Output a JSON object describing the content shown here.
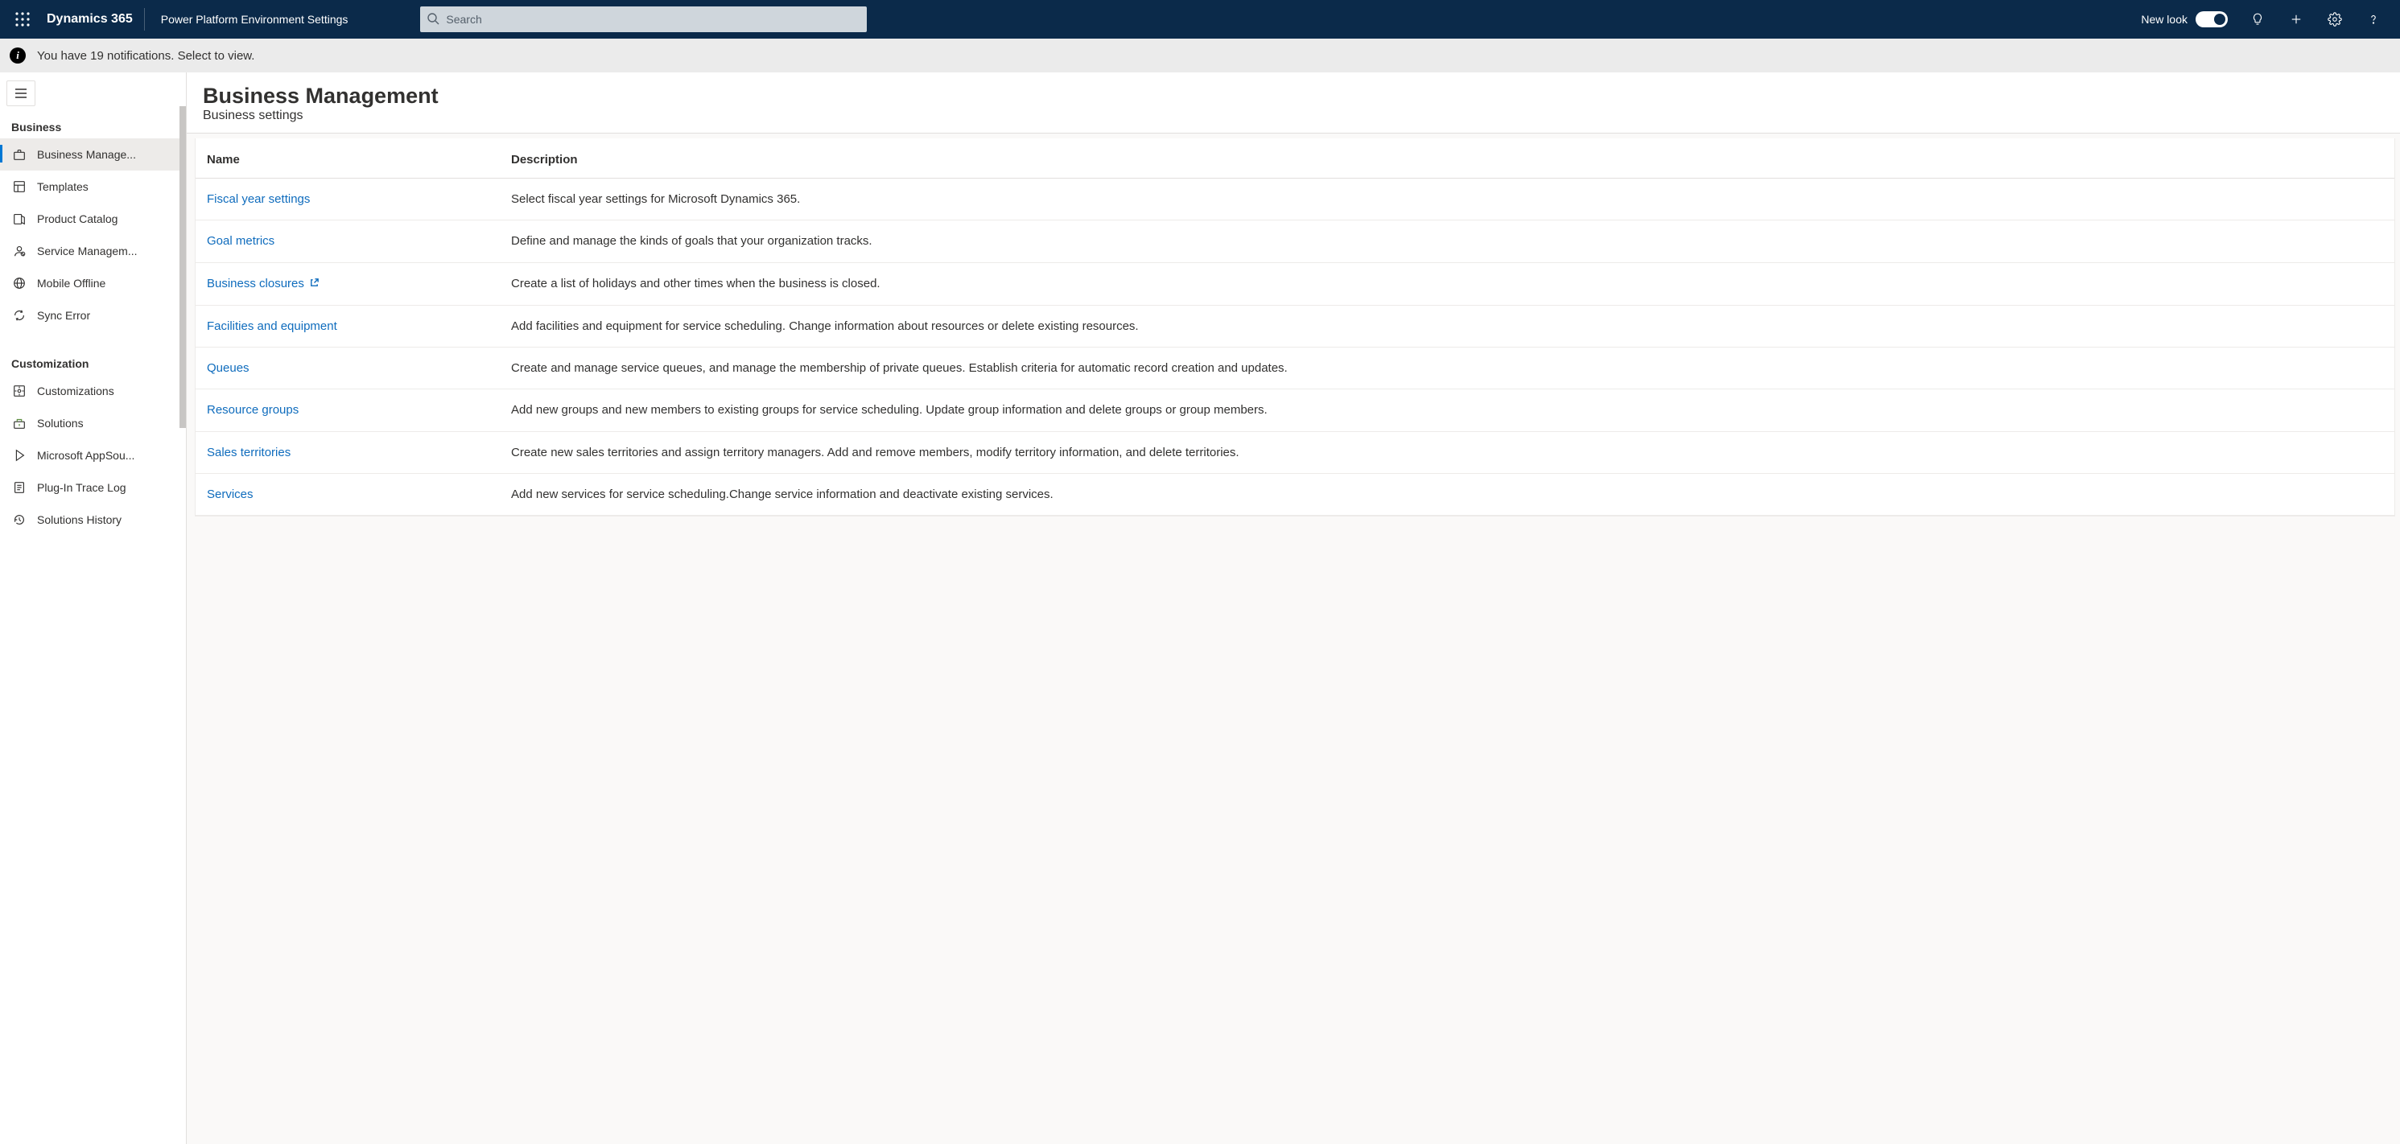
{
  "header": {
    "brand": "Dynamics 365",
    "environment": "Power Platform Environment Settings",
    "search_placeholder": "Search",
    "new_look_label": "New look"
  },
  "notification": {
    "text": "You have 19 notifications. Select to view."
  },
  "sidebar": {
    "sections": [
      {
        "title": "Business",
        "items": [
          {
            "label": "Business Manage...",
            "icon": "briefcase-icon",
            "active": true
          },
          {
            "label": "Templates",
            "icon": "templates-icon"
          },
          {
            "label": "Product Catalog",
            "icon": "product-catalog-icon"
          },
          {
            "label": "Service Managem...",
            "icon": "service-management-icon"
          },
          {
            "label": "Mobile Offline",
            "icon": "globe-icon"
          },
          {
            "label": "Sync Error",
            "icon": "sync-error-icon"
          }
        ]
      },
      {
        "title": "Customization",
        "items": [
          {
            "label": "Customizations",
            "icon": "customizations-icon"
          },
          {
            "label": "Solutions",
            "icon": "solutions-icon"
          },
          {
            "label": "Microsoft AppSou...",
            "icon": "appsource-icon"
          },
          {
            "label": "Plug-In Trace Log",
            "icon": "trace-log-icon"
          },
          {
            "label": "Solutions History",
            "icon": "history-icon"
          }
        ]
      }
    ]
  },
  "page": {
    "title": "Business Management",
    "subtitle": "Business settings",
    "columns": {
      "name": "Name",
      "description": "Description"
    },
    "rows": [
      {
        "name": "Fiscal year settings",
        "external": false,
        "description": "Select fiscal year settings for Microsoft Dynamics 365."
      },
      {
        "name": "Goal metrics",
        "external": false,
        "description": "Define and manage the kinds of goals that your organization tracks."
      },
      {
        "name": "Business closures",
        "external": true,
        "description": "Create a list of holidays and other times when the business is closed."
      },
      {
        "name": "Facilities and equipment",
        "external": false,
        "description": "Add facilities and equipment for service scheduling. Change information about resources or delete existing resources."
      },
      {
        "name": "Queues",
        "external": false,
        "description": "Create and manage service queues, and manage the membership of private queues. Establish criteria for automatic record creation and updates."
      },
      {
        "name": "Resource groups",
        "external": false,
        "description": "Add new groups and new members to existing groups for service scheduling. Update group information and delete groups or group members."
      },
      {
        "name": "Sales territories",
        "external": false,
        "description": "Create new sales territories and assign territory managers. Add and remove members, modify territory information, and delete territories."
      },
      {
        "name": "Services",
        "external": false,
        "description": "Add new services for service scheduling.Change service information and deactivate existing services."
      }
    ]
  }
}
